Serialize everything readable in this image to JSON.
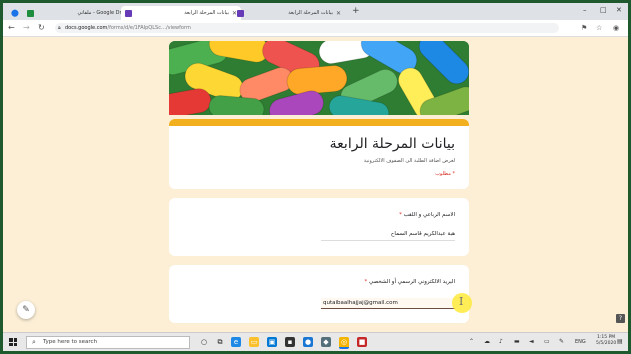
{
  "browser": {
    "tabs": [
      {
        "title": "Google Drive - ملفاتي",
        "active": false,
        "favicon_color": "#1e8e3e"
      },
      {
        "title": "بيانات المرحلة الرابعة",
        "active": true,
        "favicon_color": "#673ab7"
      },
      {
        "title": "بيانات المرحلة الرابعة",
        "active": false,
        "favicon_color": "#673ab7"
      }
    ],
    "new_tab": "+",
    "address": {
      "host": "docs.google.com",
      "path": "/forms/d/e/1FAIpQLSc…/viewform"
    },
    "window_controls": [
      "–",
      "□",
      "✕"
    ]
  },
  "form": {
    "title": "بيانات المرحلة الرابعة",
    "description": "لغرض اضافة الطلبة الى الصفوف الالكترونية",
    "required_note": "* مطلوب",
    "questions": [
      {
        "label": "الاسم الرباعي و اللقب",
        "value": "هبة عبدالكريم قاسم السماح",
        "required": true
      },
      {
        "label": "البريد الالكتروني الرسمي أو الشخصي",
        "value": "qutaibaalhajjaj@gmail.com",
        "required": true
      }
    ],
    "accent_color": "#f2b01e"
  },
  "taskbar": {
    "search_placeholder": "Type here to search",
    "language": "ENG",
    "time": "1:15 PM",
    "date": "5/5/2020"
  },
  "cursor_glyph": "I"
}
